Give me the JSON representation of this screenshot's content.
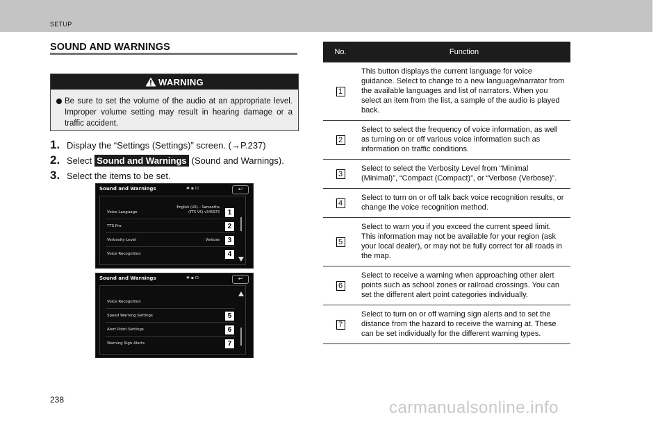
{
  "header": {
    "section": "SETUP"
  },
  "heading": "SOUND AND WARNINGS",
  "warning": {
    "label": "WARNING",
    "text": "Be sure to set the volume of the audio at an appropriate level. Improper volume setting may result in hearing damage or a traffic accident."
  },
  "steps": [
    {
      "num": "1.",
      "text": "Display the “Settings (Settings)” screen. (→P.237)"
    },
    {
      "num": "2.",
      "pre": "Select",
      "button": "Sound and Warnings",
      "post": "(Sound and Warnings)."
    },
    {
      "num": "3.",
      "text": "Select the items to be set."
    }
  ],
  "screen1": {
    "title": "Sound and Warnings",
    "status": "✱ ▪ ⊡",
    "back": "↩",
    "rows": [
      {
        "label": "Voice Language",
        "value_line1": "English (US) – Samantha",
        "value_line2": "(TTS V5) v345973",
        "callout": "1"
      },
      {
        "label": "TTS Pro",
        "value_line1": "",
        "value_line2": "",
        "callout": "2"
      },
      {
        "label": "Verbosity Level",
        "value_line1": "Verbose",
        "value_line2": "",
        "callout": "3"
      },
      {
        "label": "Voice Recognition",
        "value_line1": "",
        "value_line2": "",
        "callout": "4"
      }
    ]
  },
  "screen2": {
    "title": "Sound and Warnings",
    "status": "✱ ▪ ⊡",
    "back": "↩",
    "rows": [
      {
        "label": "Voice Recognition",
        "callout": ""
      },
      {
        "label": "Speed Warning Settings",
        "callout": "5"
      },
      {
        "label": "Alert Point Settings",
        "callout": "6"
      },
      {
        "label": "Warning Sign Alerts",
        "callout": "7"
      }
    ]
  },
  "table": {
    "col_no": "No.",
    "col_function": "Function",
    "rows": [
      {
        "no": "1",
        "text": "This button displays the current language for voice guidance. Select to change to a new language/narrator from the available languages and list of narrators. When you select an item from the list, a sample of the audio is played back."
      },
      {
        "no": "2",
        "text": "Select to select the frequency of voice information, as well as turning on or off various voice information such as information on traffic conditions."
      },
      {
        "no": "3",
        "text": "Select to select the Verbosity Level from “Minimal (Minimal)”, “Compact (Compact)”, or “Verbose (Verbose)”."
      },
      {
        "no": "4",
        "text": "Select to turn on or off talk back voice recognition results, or change the voice recognition method."
      },
      {
        "no": "5",
        "text": "Select to warn you if you exceed the current speed limit. This information may not be available for your region (ask your local dealer), or may not be fully correct for all roads in the map."
      },
      {
        "no": "6",
        "text": "Select to receive a warning when approaching other alert points such as school zones or railroad crossings. You can set the different alert point categories individually."
      },
      {
        "no": "7",
        "text": "Select to turn on or off warning sign alerts and to set the distance from the hazard to receive the warning at. These can be set individually for the different warning types."
      }
    ]
  },
  "page_number": "238",
  "watermark": "carmanualsonline.info"
}
